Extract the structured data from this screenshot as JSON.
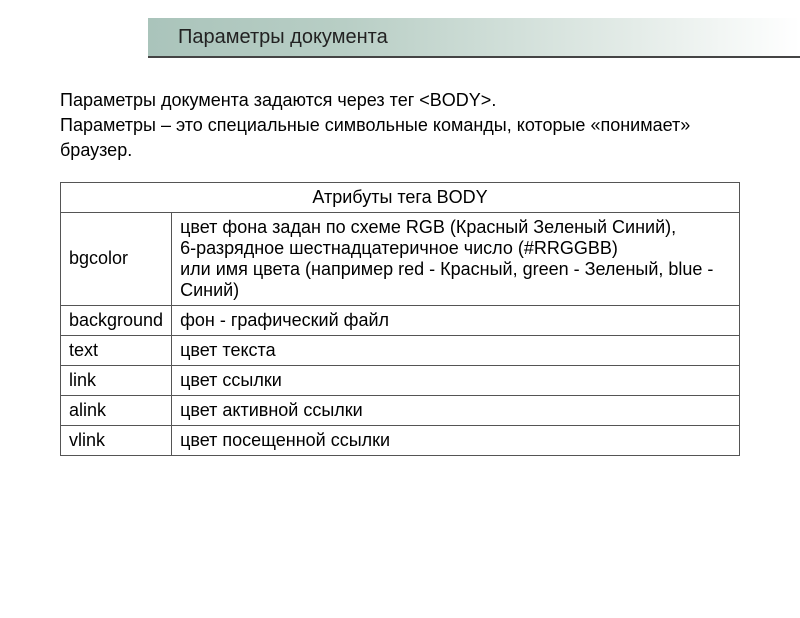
{
  "header": {
    "title": "Параметры документа"
  },
  "intro": {
    "line1": "Параметры документа задаются через тег <BODY>.",
    "line2": "Параметры – это специальные символьные команды, которые «понимает» браузер."
  },
  "table": {
    "caption": "Атрибуты тега BODY",
    "rows": [
      {
        "attr": "bgcolor",
        "desc": "цвет фона задан по схеме RGB (Красный Зеленый Синий),\n6-разрядное шестнадцатеричное число (#RRGGBB)\nили имя цвета (например red - Красный, green - Зеленый, blue - Синий)"
      },
      {
        "attr": "background",
        "desc": "фон - графический файл"
      },
      {
        "attr": "text",
        "desc": "цвет текста"
      },
      {
        "attr": "link",
        "desc": "цвет ссылки"
      },
      {
        "attr": "alink",
        "desc": "цвет активной ссылки"
      },
      {
        "attr": "vlink",
        "desc": "цвет посещенной ссылки"
      }
    ]
  }
}
